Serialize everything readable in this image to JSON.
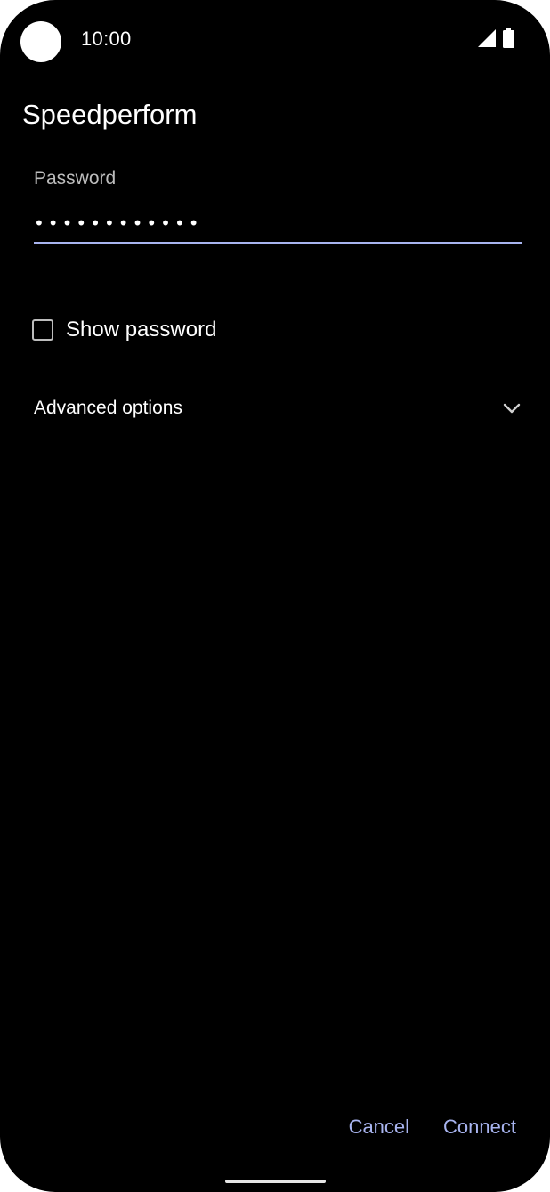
{
  "status_bar": {
    "time": "10:00",
    "icons": [
      "signal-icon",
      "battery-icon"
    ]
  },
  "dialog": {
    "title": "Speedperform",
    "password": {
      "label": "Password",
      "value": "••••••••••••"
    },
    "show_password": {
      "label": "Show password",
      "checked": false
    },
    "advanced_options": {
      "label": "Advanced options",
      "icon": "chevron-down-icon"
    },
    "buttons": {
      "cancel": "Cancel",
      "connect": "Connect"
    }
  },
  "colors": {
    "background": "#000000",
    "accent": "#a8b4ef",
    "label_gray": "#bdbdbd"
  }
}
